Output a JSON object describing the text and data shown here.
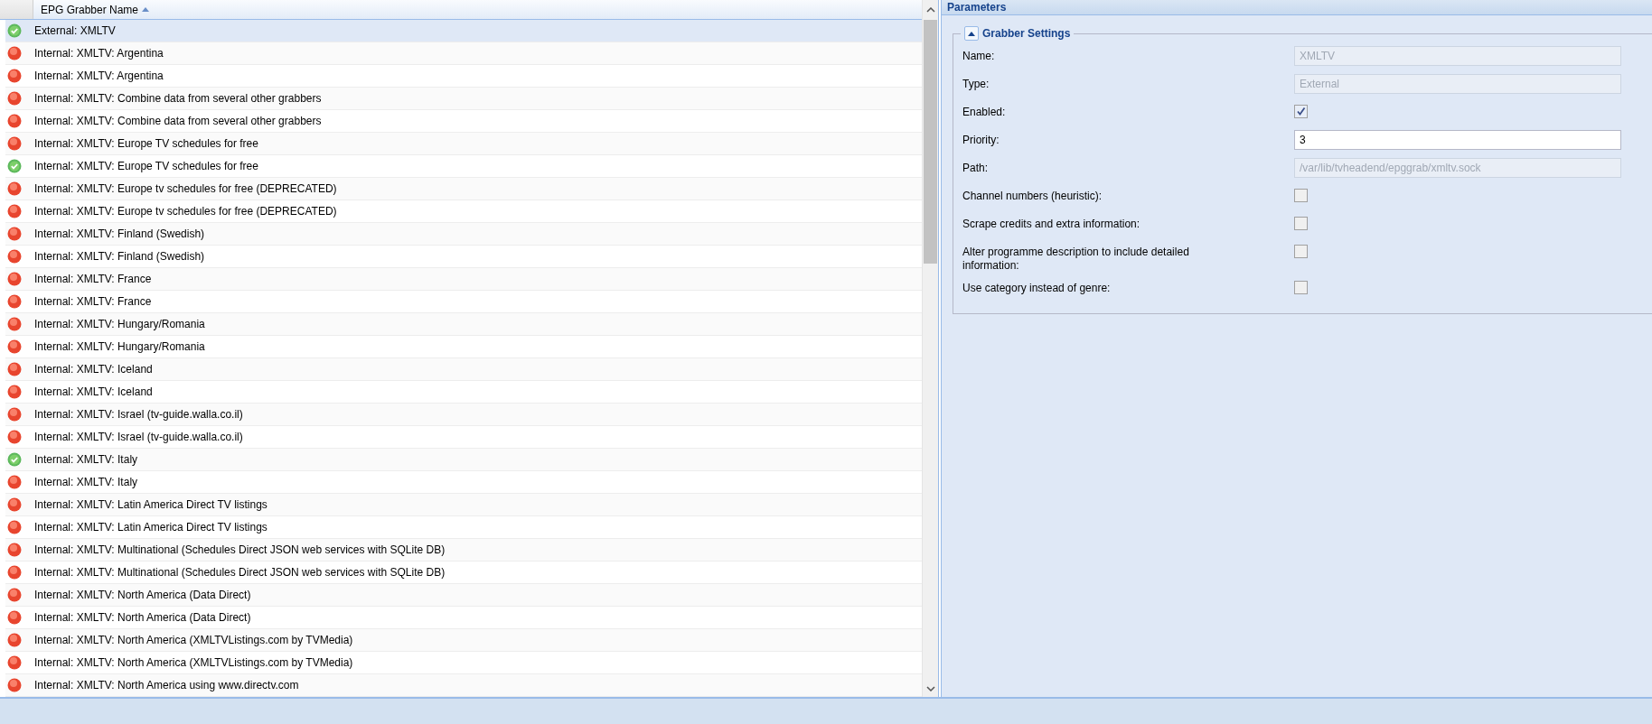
{
  "grid": {
    "columns": [
      {
        "label": "EPG Grabber Name",
        "sorted_ascending": true
      }
    ],
    "rows": [
      {
        "name": "External: XMLTV",
        "ok": true,
        "selected": true
      },
      {
        "name": "Internal: XMLTV: Argentina",
        "ok": false,
        "selected": false
      },
      {
        "name": "Internal: XMLTV: Argentina",
        "ok": false,
        "selected": false
      },
      {
        "name": "Internal: XMLTV: Combine data from several other grabbers",
        "ok": false,
        "selected": false
      },
      {
        "name": "Internal: XMLTV: Combine data from several other grabbers",
        "ok": false,
        "selected": false
      },
      {
        "name": "Internal: XMLTV: Europe TV schedules for free",
        "ok": false,
        "selected": false
      },
      {
        "name": "Internal: XMLTV: Europe TV schedules for free",
        "ok": true,
        "selected": false
      },
      {
        "name": "Internal: XMLTV: Europe tv schedules for free (DEPRECATED)",
        "ok": false,
        "selected": false
      },
      {
        "name": "Internal: XMLTV: Europe tv schedules for free (DEPRECATED)",
        "ok": false,
        "selected": false
      },
      {
        "name": "Internal: XMLTV: Finland (Swedish)",
        "ok": false,
        "selected": false
      },
      {
        "name": "Internal: XMLTV: Finland (Swedish)",
        "ok": false,
        "selected": false
      },
      {
        "name": "Internal: XMLTV: France",
        "ok": false,
        "selected": false
      },
      {
        "name": "Internal: XMLTV: France",
        "ok": false,
        "selected": false
      },
      {
        "name": "Internal: XMLTV: Hungary/Romania",
        "ok": false,
        "selected": false
      },
      {
        "name": "Internal: XMLTV: Hungary/Romania",
        "ok": false,
        "selected": false
      },
      {
        "name": "Internal: XMLTV: Iceland",
        "ok": false,
        "selected": false
      },
      {
        "name": "Internal: XMLTV: Iceland",
        "ok": false,
        "selected": false
      },
      {
        "name": "Internal: XMLTV: Israel (tv-guide.walla.co.il)",
        "ok": false,
        "selected": false
      },
      {
        "name": "Internal: XMLTV: Israel (tv-guide.walla.co.il)",
        "ok": false,
        "selected": false
      },
      {
        "name": "Internal: XMLTV: Italy",
        "ok": true,
        "selected": false
      },
      {
        "name": "Internal: XMLTV: Italy",
        "ok": false,
        "selected": false
      },
      {
        "name": "Internal: XMLTV: Latin America Direct TV listings",
        "ok": false,
        "selected": false
      },
      {
        "name": "Internal: XMLTV: Latin America Direct TV listings",
        "ok": false,
        "selected": false
      },
      {
        "name": "Internal: XMLTV: Multinational (Schedules Direct JSON web services with SQLite DB)",
        "ok": false,
        "selected": false
      },
      {
        "name": "Internal: XMLTV: Multinational (Schedules Direct JSON web services with SQLite DB)",
        "ok": false,
        "selected": false
      },
      {
        "name": "Internal: XMLTV: North America (Data Direct)",
        "ok": false,
        "selected": false
      },
      {
        "name": "Internal: XMLTV: North America (Data Direct)",
        "ok": false,
        "selected": false
      },
      {
        "name": "Internal: XMLTV: North America (XMLTVListings.com by TVMedia)",
        "ok": false,
        "selected": false
      },
      {
        "name": "Internal: XMLTV: North America (XMLTVListings.com by TVMedia)",
        "ok": false,
        "selected": false
      },
      {
        "name": "Internal: XMLTV: North America using www.directv.com",
        "ok": false,
        "selected": false
      }
    ]
  },
  "parameters": {
    "title": "Parameters",
    "section": {
      "title": "Grabber Settings",
      "expanded": true,
      "fields": [
        {
          "kind": "text",
          "label": "Name:",
          "value": "XMLTV",
          "disabled": true
        },
        {
          "kind": "text",
          "label": "Type:",
          "value": "External",
          "disabled": true
        },
        {
          "kind": "checkbox",
          "label": "Enabled:",
          "checked": true
        },
        {
          "kind": "text",
          "label": "Priority:",
          "value": "3",
          "disabled": false
        },
        {
          "kind": "text",
          "label": "Path:",
          "value": "/var/lib/tvheadend/epggrab/xmltv.sock",
          "disabled": true
        },
        {
          "kind": "checkbox",
          "label": "Channel numbers (heuristic):",
          "checked": false
        },
        {
          "kind": "checkbox",
          "label": "Scrape credits and extra information:",
          "checked": false
        },
        {
          "kind": "checkbox",
          "label": "Alter programme description to include detailed information:",
          "checked": false
        },
        {
          "kind": "checkbox",
          "label": "Use category instead of genre:",
          "checked": false
        }
      ]
    }
  }
}
